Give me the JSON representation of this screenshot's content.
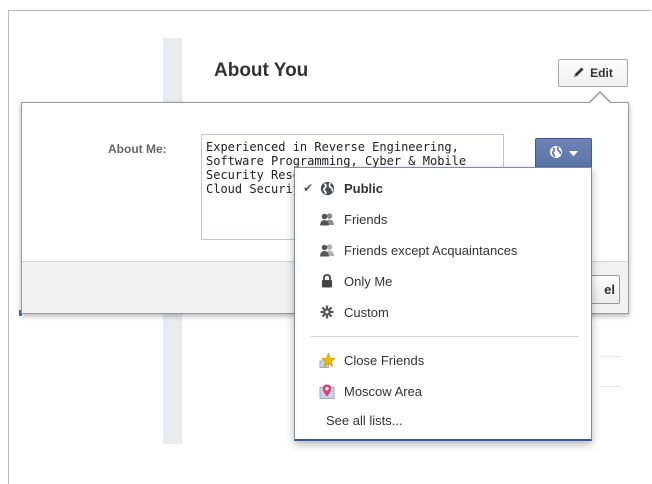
{
  "section": {
    "title": "About You",
    "edit_label": "Edit"
  },
  "editor": {
    "field_label": "About Me:",
    "text": "Experienced in Reverse Engineering,\nSoftware Programming, Cyber & Mobile\nSecurity Research, Penetration Testing,\nCloud Security",
    "cancel_label_visible": "el"
  },
  "privacy_menu": {
    "items": [
      {
        "label": "Public",
        "icon": "globe-icon",
        "selected": true
      },
      {
        "label": "Friends",
        "icon": "friends-icon",
        "selected": false
      },
      {
        "label": "Friends except Acquaintances",
        "icon": "friends-except-icon",
        "selected": false
      },
      {
        "label": "Only Me",
        "icon": "lock-icon",
        "selected": false
      },
      {
        "label": "Custom",
        "icon": "gear-icon",
        "selected": false
      }
    ],
    "lists": [
      {
        "label": "Close Friends",
        "icon": "star-icon"
      },
      {
        "label": "Moscow Area",
        "icon": "location-icon"
      }
    ],
    "see_all_label": "See all lists...",
    "checkmark": "✔"
  },
  "colors": {
    "facebook_blue": "#3b5998",
    "button_blue": "#6d84b4"
  }
}
